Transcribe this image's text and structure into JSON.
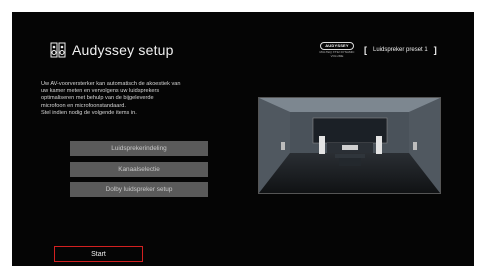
{
  "header": {
    "title": "Audyssey setup",
    "icon": "audyssey-speaker-icon",
    "logo_text": "AUDYSSEY",
    "logo_sub": "MULTEQ XT32 DYNAMIC VOLUME",
    "preset_label": "Luidspreker preset 1",
    "preset_bracket_open": "[",
    "preset_bracket_close": "]"
  },
  "description": {
    "line1": "Uw AV-voorversterker kan automatisch de akoestiek van",
    "line2": "uw kamer meten en vervolgens uw luidsprekers",
    "line3": "optimaliseren met behulp van de bijgeleverde",
    "line4": "microfoon en microfoonstandaard.",
    "line5": "Stel indien nodig de volgende items in."
  },
  "menu": {
    "items": [
      {
        "label": "Luidsprekerindeling"
      },
      {
        "label": "Kanaalselectie"
      },
      {
        "label": "Dolby luidspreker setup"
      }
    ]
  },
  "start_button": {
    "label": "Start"
  },
  "colors": {
    "background": "#050505",
    "menu_bg": "#5a5a5a",
    "accent_red": "#d32020"
  }
}
